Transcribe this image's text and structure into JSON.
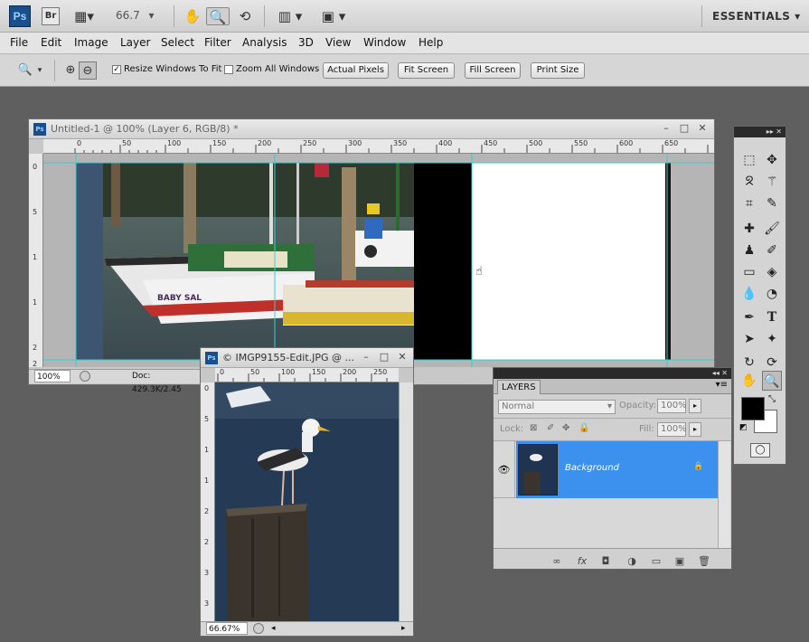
{
  "app": {
    "logo": "Ps",
    "bridge": "Br",
    "zoom": "66.7",
    "workspace": "ESSENTIALS"
  },
  "menu": [
    "File",
    "Edit",
    "Image",
    "Layer",
    "Select",
    "Filter",
    "Analysis",
    "3D",
    "View",
    "Window",
    "Help"
  ],
  "options": {
    "resize_windows": "Resize Windows To Fit",
    "zoom_all": "Zoom All Windows",
    "actual_pixels": "Actual Pixels",
    "fit_screen": "Fit Screen",
    "fill_screen": "Fill Screen",
    "print_size": "Print Size"
  },
  "doc1": {
    "title": "Untitled-1 @ 100% (Layer 6, RGB/8) *",
    "zoom": "100%",
    "doc_info": "Doc: 429.3K/2.45",
    "ruler_h": [
      "0",
      "50",
      "100",
      "150",
      "200",
      "250",
      "300",
      "350",
      "400",
      "450",
      "500",
      "550",
      "600",
      "650"
    ],
    "ruler_v": [
      "0",
      "5",
      "1",
      "1",
      "2",
      "2"
    ]
  },
  "doc2": {
    "title": "© IMGP9155-Edit.JPG @ ...",
    "zoom": "66.67%",
    "ruler_h": [
      "0",
      "50",
      "100",
      "150",
      "200",
      "250"
    ],
    "ruler_v": [
      "0",
      "5",
      "1",
      "1",
      "2",
      "2",
      "3",
      "3"
    ]
  },
  "layers_panel": {
    "tab": "LAYERS",
    "blend_mode": "Normal",
    "opacity_label": "Opacity:",
    "opacity_value": "100%",
    "lock_label": "Lock:",
    "fill_label": "Fill:",
    "fill_value": "100%",
    "layer_name": "Background"
  },
  "colors": {
    "selection": "#3c91ee",
    "guides": "#38d0d0"
  }
}
